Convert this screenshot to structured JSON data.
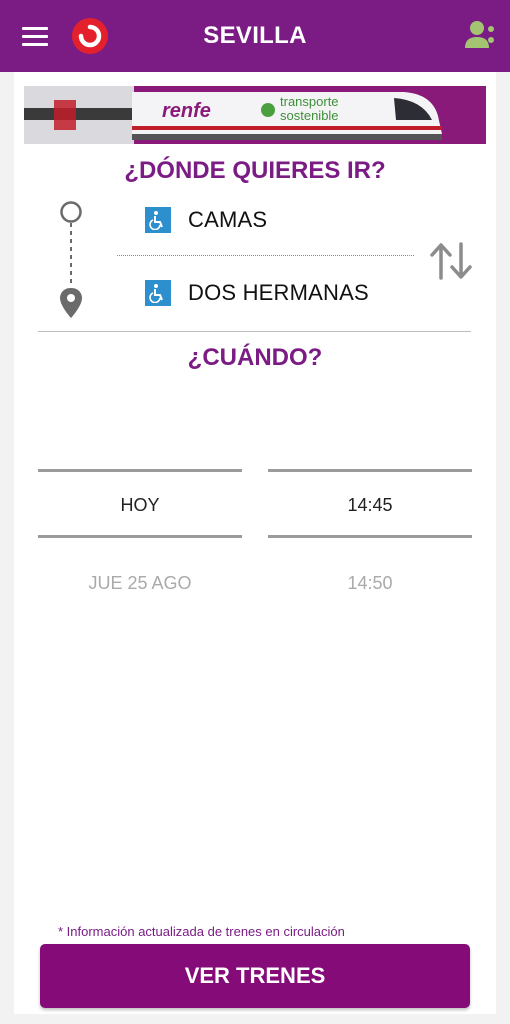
{
  "colors": {
    "brand": "#7b1c85",
    "button": "#850c78",
    "logo_red": "#e3202b",
    "accessibility_blue": "#2e8fcf",
    "users_icon": "#a4c472"
  },
  "header": {
    "title": "SEVILLA",
    "menu_icon": "hamburger-menu-icon",
    "logo_icon": "cercanias-logo-icon",
    "profile_icon": "users-icon"
  },
  "banner": {
    "brand_text": "renfe",
    "slogan_line1": "transporte",
    "slogan_line2": "sostenible"
  },
  "where": {
    "heading": "¿DÓNDE QUIERES IR?",
    "origin": {
      "name": "CAMAS",
      "icon": "wheelchair-icon"
    },
    "destination": {
      "name": "DOS HERMANAS",
      "icon": "wheelchair-icon"
    },
    "swap_icon": "swap-vertical-icon"
  },
  "when": {
    "heading": "¿CUÁNDO?",
    "date": {
      "selected": "HOY",
      "next": "JUE 25 AGO"
    },
    "time": {
      "selected": "14:45",
      "next": "14:50"
    }
  },
  "footer": {
    "note": "* Información actualizada de trenes en circulación",
    "cta_label": "VER TRENES"
  }
}
